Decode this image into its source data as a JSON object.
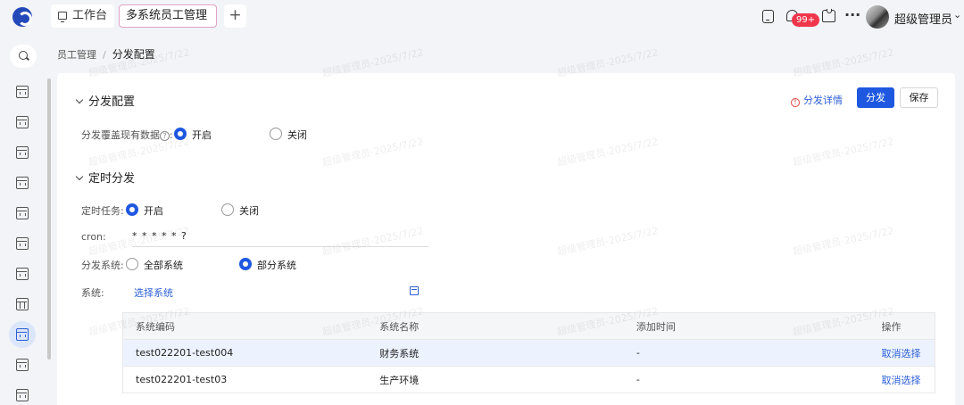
{
  "topbar": {
    "tabs": [
      {
        "label": "工作台"
      },
      {
        "label": "多系统员工管理"
      }
    ],
    "badge": "99+",
    "more": "···",
    "user": "超级管理员"
  },
  "breadcrumb": {
    "parent": "员工管理",
    "current": "分发配置"
  },
  "actions": {
    "detail": "分发详情",
    "distribute": "分发",
    "save": "保存"
  },
  "section1": {
    "title": "分发配置",
    "override_label": "分发覆盖现有数据",
    "help": "?",
    "colon": ":",
    "on": "开启",
    "off": "关闭"
  },
  "section2": {
    "title": "定时分发",
    "task_label": "定时任务",
    "on": "开启",
    "off": "关闭",
    "cron_label": "cron",
    "cron_value": "* * * * * ?",
    "system_label": "分发系统",
    "all_systems": "全部系统",
    "partial_systems": "部分系统",
    "systems_label": "系统",
    "select_link": "选择系统"
  },
  "table": {
    "headers": [
      "系统编码",
      "系统名称",
      "添加时间",
      "操作"
    ],
    "rows": [
      {
        "code": "test022201-test004",
        "name": "财务系统",
        "time": "-",
        "op": "取消选择"
      },
      {
        "code": "test022201-test03",
        "name": "生产环境",
        "time": "-",
        "op": "取消选择"
      }
    ]
  },
  "watermark": "超级管理员-2025/7/22",
  "colors": {
    "primary": "#1f58e0",
    "link": "#2c5fd6",
    "badge": "#f0364b"
  }
}
